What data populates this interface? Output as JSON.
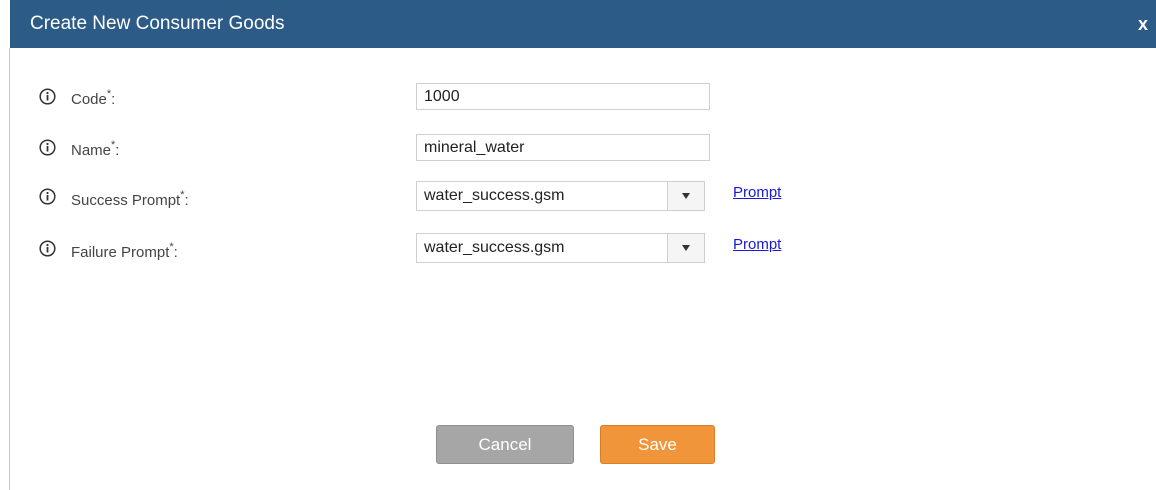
{
  "dialog": {
    "title": "Create New Consumer Goods",
    "close_label": "x"
  },
  "form": {
    "code": {
      "label": "Code",
      "required_mark": "*",
      "suffix": ":",
      "value": "1000"
    },
    "name": {
      "label": "Name",
      "required_mark": "*",
      "suffix": ":",
      "value": "mineral_water"
    },
    "success_prompt": {
      "label": "Success Prompt",
      "required_mark": "*",
      "suffix": ":",
      "value": "water_success.gsm",
      "link_label": "Prompt"
    },
    "failure_prompt": {
      "label": "Failure Prompt",
      "required_mark": "*",
      "suffix": ":",
      "value": "water_success.gsm",
      "link_label": "Prompt"
    }
  },
  "actions": {
    "cancel_label": "Cancel",
    "save_label": "Save"
  },
  "colors": {
    "titlebar": "#2c5b88",
    "save": "#f0953a",
    "cancel": "#a6a6a6",
    "link": "#1a1ad6"
  },
  "icons": {
    "info": "info-icon",
    "dropdown": "dropdown-arrow-icon"
  }
}
